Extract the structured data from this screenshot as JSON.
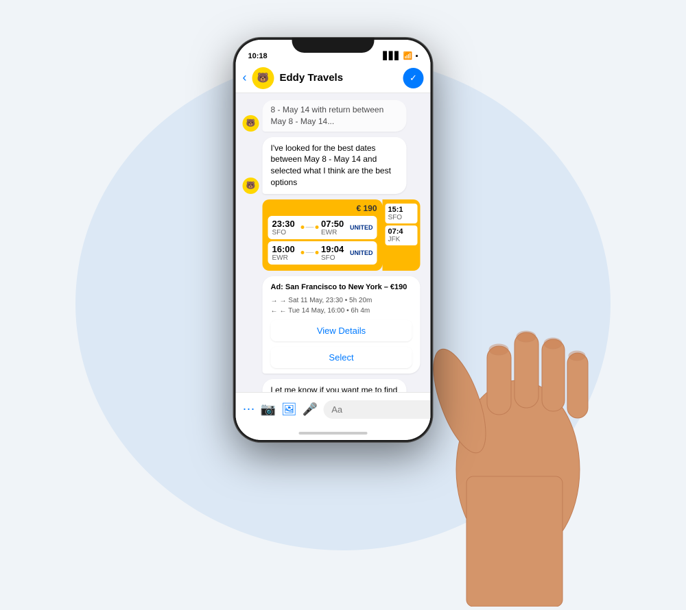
{
  "scene": {
    "bg_color": "#dce8f5"
  },
  "status_bar": {
    "time": "10:18",
    "signal": "▋▋▋",
    "wifi": "WiFi",
    "battery": "🔋"
  },
  "header": {
    "back_label": "‹",
    "title": "Eddy Travels",
    "avatar_emoji": "✈",
    "action_icon": "✓"
  },
  "chat": {
    "truncated_message": "8 - May 14 with return between May 8 - May 14...",
    "bot_message_1": "I've looked for the best dates between May 8 - May 14 and selected what I think are the best options",
    "flight_card": {
      "price": "€ 190",
      "outbound": {
        "depart_time": "23:30",
        "arrive_time": "07:50",
        "from": "SFO",
        "to": "EWR"
      },
      "return": {
        "depart_time": "16:00",
        "arrive_time": "19:04",
        "from": "EWR",
        "to": "SFO"
      },
      "peek_outbound_time": "15:1",
      "peek_outbound_from": "SFO",
      "peek_return_time": "07:4",
      "peek_return_to": "JFK"
    },
    "flight_info": {
      "title": "Ad: San Francisco to New York – €190",
      "outbound_detail": "→ Sat 11 May, 23:30 • 5h 20m",
      "return_detail": "← Tue 14 May, 16:00 • 6h 4m"
    },
    "view_details_label": "View Details",
    "select_label": "Select",
    "bot_message_2": "Let me know if you want me to find you hotel, filter flights by airline/departure time or change the flight type to one-way/return"
  },
  "message_bar": {
    "placeholder": "Aa",
    "icons": [
      "⋯",
      "📷",
      "🖼",
      "🎤",
      "😊",
      "👍"
    ]
  }
}
